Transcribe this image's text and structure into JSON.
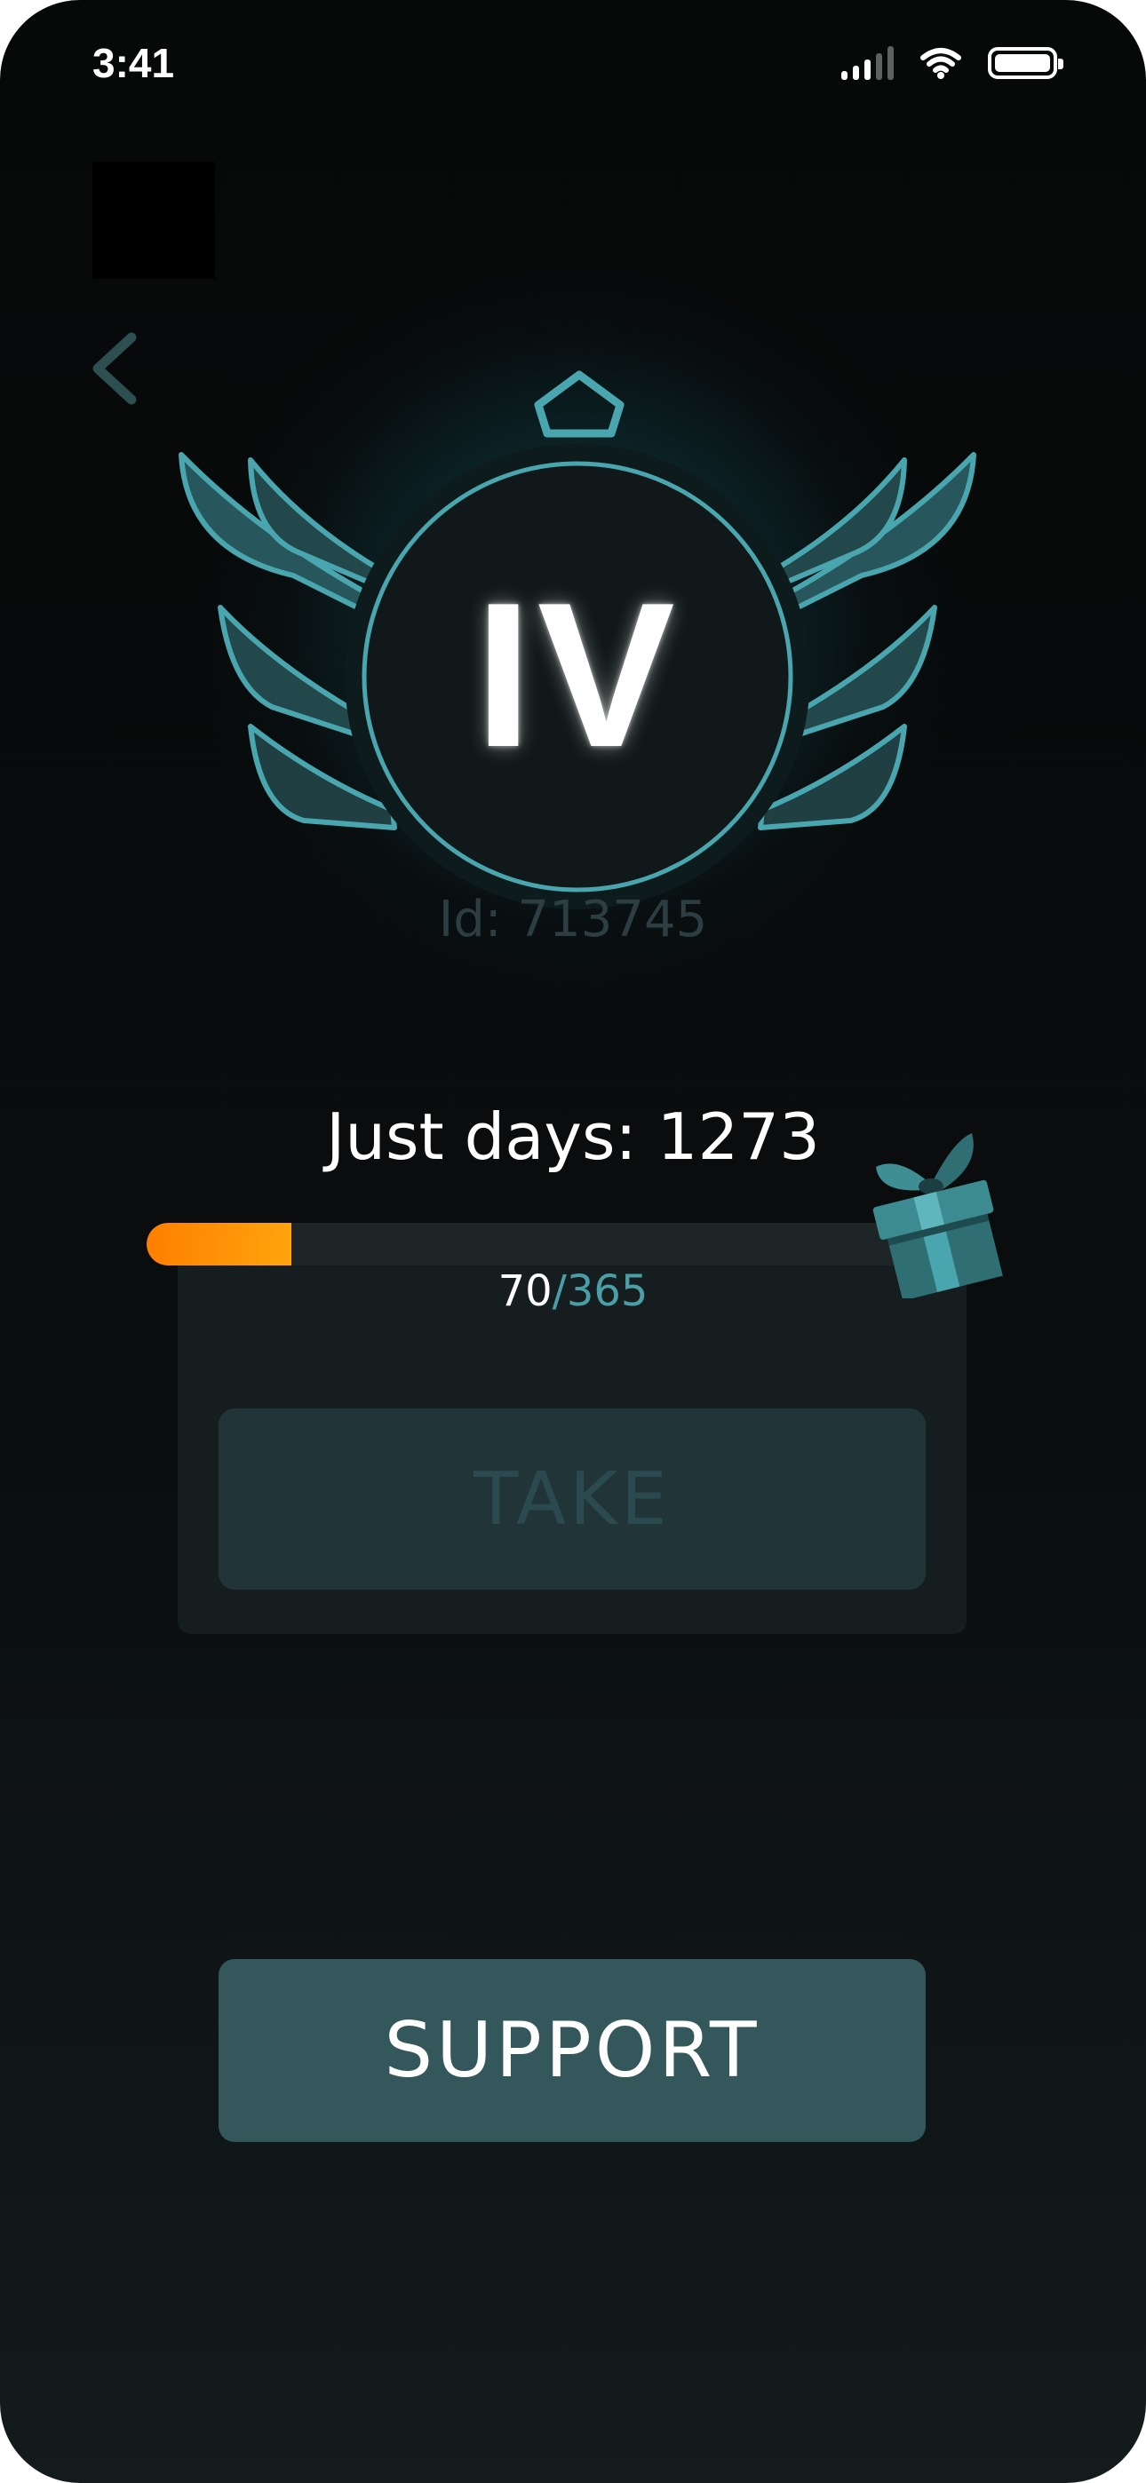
{
  "status_bar": {
    "time": "3:41",
    "icons": [
      "cellular-signal-icon",
      "wifi-icon",
      "battery-icon"
    ]
  },
  "nav": {
    "back_icon": "chevron-left-icon"
  },
  "badge": {
    "rank_label": "IV",
    "id_text": "Id: 713745"
  },
  "streak": {
    "days_text": "Just days: 1273"
  },
  "progress": {
    "current": "70",
    "separator": "/",
    "total": "365",
    "fraction": 0.19,
    "reward_icon": "gift-box-icon"
  },
  "buttons": {
    "take_label": "TAKE",
    "take_enabled": false,
    "support_label": "SUPPORT"
  },
  "colors": {
    "accent_teal": "#4aa6ae",
    "progress_orange_start": "#ff7f00",
    "progress_orange_end": "#ffa40d",
    "button_primary": "#33575a",
    "button_disabled": "#213539"
  }
}
